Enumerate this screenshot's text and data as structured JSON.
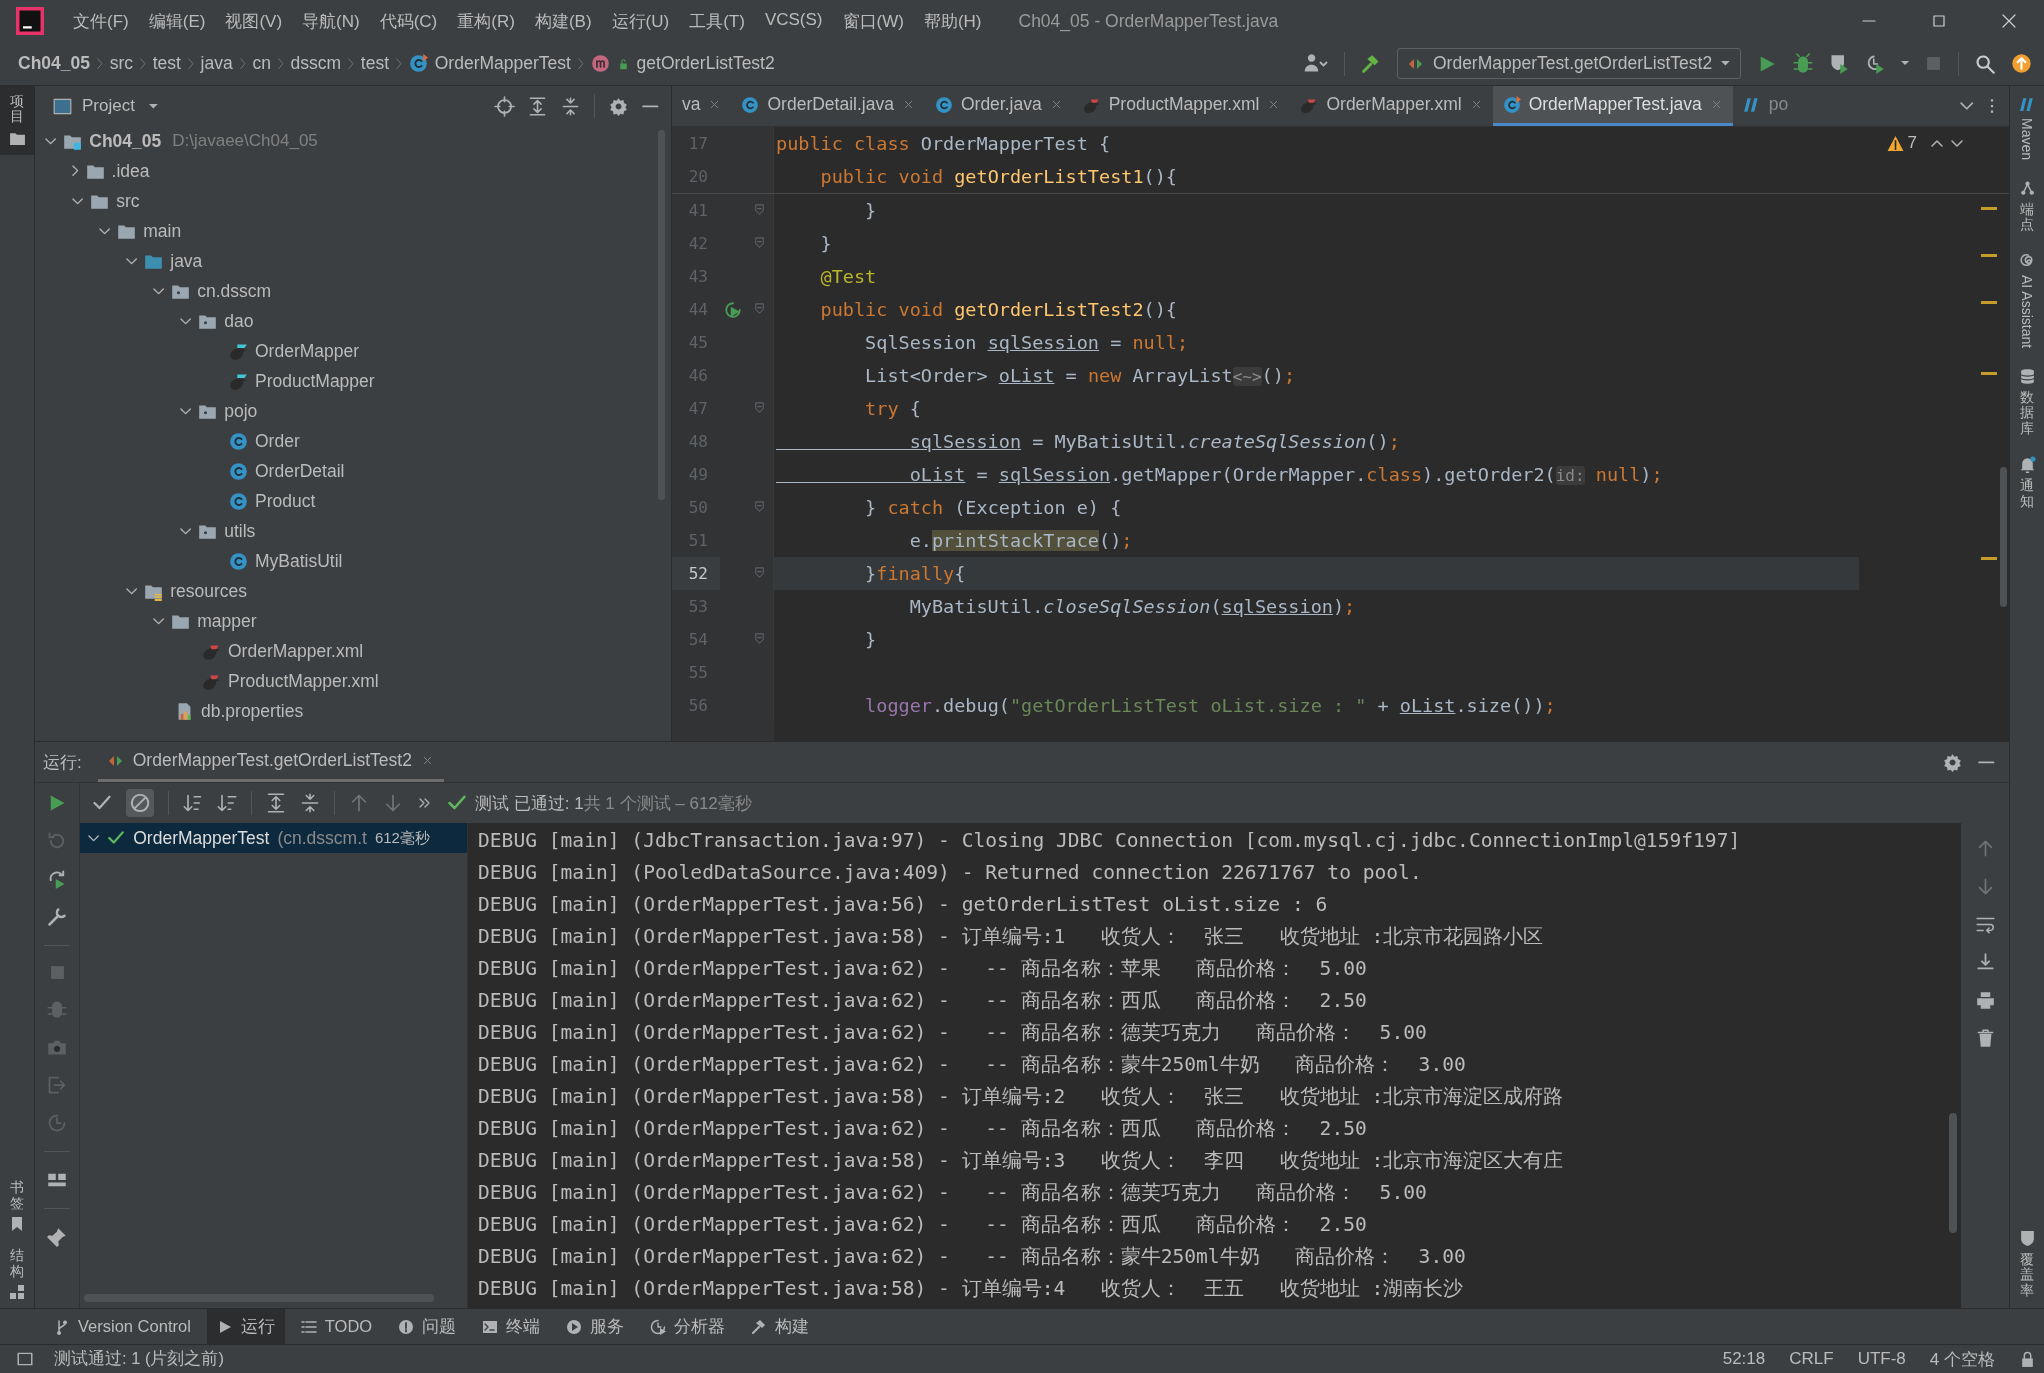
{
  "window": {
    "title": "Ch04_05 - OrderMapperTest.java"
  },
  "menu": [
    "文件(F)",
    "编辑(E)",
    "视图(V)",
    "导航(N)",
    "代码(C)",
    "重构(R)",
    "构建(B)",
    "运行(U)",
    "工具(T)",
    "VCS(S)",
    "窗口(W)",
    "帮助(H)"
  ],
  "breadcrumbs": [
    {
      "label": "Ch04_05",
      "kind": "module"
    },
    {
      "label": "src",
      "kind": "dir"
    },
    {
      "label": "test",
      "kind": "dir"
    },
    {
      "label": "java",
      "kind": "dir"
    },
    {
      "label": "cn",
      "kind": "dir"
    },
    {
      "label": "dsscm",
      "kind": "dir"
    },
    {
      "label": "test",
      "kind": "dir"
    },
    {
      "label": "OrderMapperTest",
      "kind": "class"
    },
    {
      "label": "getOrderListTest2",
      "kind": "method"
    }
  ],
  "run_config": {
    "label": "OrderMapperTest.getOrderListTest2"
  },
  "left_stripe": {
    "top": [
      {
        "label": "项目",
        "kind": "project",
        "selected": true
      }
    ],
    "bottom": [
      {
        "label": "书签",
        "kind": "bookmarks",
        "selected": false
      },
      {
        "label": "结构",
        "kind": "structure",
        "selected": false
      }
    ]
  },
  "right_stripe": {
    "top": [
      {
        "label": "Maven",
        "kind": "maven"
      },
      {
        "label": "端点",
        "kind": "endpoints"
      },
      {
        "label": "AI Assistant",
        "kind": "ai"
      },
      {
        "label": "数据库",
        "kind": "database"
      },
      {
        "label": "通知",
        "kind": "notifications"
      }
    ],
    "bottom": [
      {
        "label": "覆盖率",
        "kind": "coverage"
      }
    ]
  },
  "project": {
    "title": "Project",
    "tree": [
      {
        "label": "Ch04_05",
        "path": "D:\\javaee\\Ch04_05",
        "kind": "module",
        "expanded": true,
        "children": [
          {
            "label": ".idea",
            "kind": "folder",
            "expanded": false
          },
          {
            "label": "src",
            "kind": "folder",
            "expanded": true,
            "children": [
              {
                "label": "main",
                "kind": "folder",
                "expanded": true,
                "children": [
                  {
                    "label": "java",
                    "kind": "source",
                    "expanded": true,
                    "children": [
                      {
                        "label": "cn.dsscm",
                        "kind": "package",
                        "expanded": true,
                        "children": [
                          {
                            "label": "dao",
                            "kind": "package",
                            "expanded": true,
                            "children": [
                              {
                                "label": "OrderMapper",
                                "kind": "mapper"
                              },
                              {
                                "label": "ProductMapper",
                                "kind": "mapper"
                              }
                            ]
                          },
                          {
                            "label": "pojo",
                            "kind": "package",
                            "expanded": true,
                            "children": [
                              {
                                "label": "Order",
                                "kind": "class"
                              },
                              {
                                "label": "OrderDetail",
                                "kind": "class"
                              },
                              {
                                "label": "Product",
                                "kind": "class"
                              }
                            ]
                          },
                          {
                            "label": "utils",
                            "kind": "package",
                            "expanded": true,
                            "children": [
                              {
                                "label": "MyBatisUtil",
                                "kind": "class"
                              }
                            ]
                          }
                        ]
                      }
                    ]
                  },
                  {
                    "label": "resources",
                    "kind": "resources",
                    "expanded": true,
                    "children": [
                      {
                        "label": "mapper",
                        "kind": "folder",
                        "expanded": true,
                        "children": [
                          {
                            "label": "OrderMapper.xml",
                            "kind": "xml"
                          },
                          {
                            "label": "ProductMapper.xml",
                            "kind": "xml"
                          }
                        ]
                      },
                      {
                        "label": "db.properties",
                        "kind": "properties"
                      }
                    ]
                  }
                ]
              }
            ]
          }
        ]
      }
    ]
  },
  "editor": {
    "tabs": [
      {
        "label": "va",
        "kind": "plain",
        "selected": false,
        "closable": true
      },
      {
        "label": "OrderDetail.java",
        "kind": "class",
        "selected": false,
        "closable": true
      },
      {
        "label": "Order.java",
        "kind": "class",
        "selected": false,
        "closable": true
      },
      {
        "label": "ProductMapper.xml",
        "kind": "xml",
        "selected": false,
        "closable": true
      },
      {
        "label": "OrderMapper.xml",
        "kind": "xml",
        "selected": false,
        "closable": true
      },
      {
        "label": "OrderMapperTest.java",
        "kind": "test-class",
        "selected": true,
        "closable": true
      },
      {
        "label": "po",
        "kind": "maven",
        "selected": false,
        "closable": false
      }
    ],
    "warnings": "7",
    "sticky_lines": [
      {
        "number": "17",
        "tokens": [
          {
            "text": "public class ",
            "kind": "keyword"
          },
          {
            "text": "OrderMapperTest {",
            "kind": "plain"
          }
        ]
      },
      {
        "number": "20",
        "tokens": [
          {
            "text": "    public void ",
            "kind": "keyword"
          },
          {
            "text": "getOrderListTest1",
            "kind": "method"
          },
          {
            "text": "(){",
            "kind": "plain"
          }
        ]
      }
    ],
    "lines": [
      {
        "number": "41",
        "fold": true,
        "run_marker": false,
        "current": false,
        "tokens": [
          {
            "text": "        }",
            "kind": "plain"
          }
        ]
      },
      {
        "number": "42",
        "fold": true,
        "run_marker": false,
        "current": false,
        "tokens": [
          {
            "text": "    }",
            "kind": "plain"
          }
        ]
      },
      {
        "number": "43",
        "fold": false,
        "run_marker": false,
        "current": false,
        "tokens": [
          {
            "text": "    @Test",
            "kind": "annotation"
          }
        ]
      },
      {
        "number": "44",
        "fold": true,
        "run_marker": true,
        "current": false,
        "tokens": [
          {
            "text": "    public void ",
            "kind": "keyword"
          },
          {
            "text": "getOrderListTest2",
            "kind": "method"
          },
          {
            "text": "(){",
            "kind": "plain"
          }
        ]
      },
      {
        "number": "45",
        "fold": false,
        "run_marker": false,
        "current": false,
        "tokens": [
          {
            "text": "        SqlSession ",
            "kind": "plain"
          },
          {
            "text": "sqlSession",
            "kind": "variable"
          },
          {
            "text": " = ",
            "kind": "plain"
          },
          {
            "text": "null;",
            "kind": "keyword"
          }
        ]
      },
      {
        "number": "46",
        "fold": false,
        "run_marker": false,
        "current": false,
        "tokens": [
          {
            "text": "        List<Order> ",
            "kind": "plain"
          },
          {
            "text": "oList",
            "kind": "variable"
          },
          {
            "text": " = ",
            "kind": "plain"
          },
          {
            "text": "new ",
            "kind": "keyword"
          },
          {
            "text": "ArrayList",
            "kind": "plain"
          },
          {
            "text": "<~>",
            "kind": "hint"
          },
          {
            "text": "()",
            "kind": "plain"
          },
          {
            "text": ";",
            "kind": "keyword"
          }
        ]
      },
      {
        "number": "47",
        "fold": true,
        "run_marker": false,
        "current": false,
        "tokens": [
          {
            "text": "        try ",
            "kind": "keyword"
          },
          {
            "text": "{",
            "kind": "plain"
          }
        ]
      },
      {
        "number": "48",
        "fold": false,
        "run_marker": false,
        "current": false,
        "tokens": [
          {
            "text": "            sqlSession",
            "kind": "variable"
          },
          {
            "text": " = MyBatisUtil.",
            "kind": "plain"
          },
          {
            "text": "createSqlSession",
            "kind": "static"
          },
          {
            "text": "()",
            "kind": "plain"
          },
          {
            "text": ";",
            "kind": "keyword"
          }
        ]
      },
      {
        "number": "49",
        "fold": false,
        "run_marker": false,
        "current": false,
        "tokens": [
          {
            "text": "            oList",
            "kind": "variable"
          },
          {
            "text": " = ",
            "kind": "plain"
          },
          {
            "text": "sqlSession",
            "kind": "variable"
          },
          {
            "text": ".getMapper(OrderMapper.",
            "kind": "plain"
          },
          {
            "text": "class",
            "kind": "keyword"
          },
          {
            "text": ").getOrder2(",
            "kind": "plain"
          },
          {
            "text": "id:",
            "kind": "hint"
          },
          {
            "text": " null",
            "kind": "keyword"
          },
          {
            "text": ")",
            "kind": "plain"
          },
          {
            "text": ";",
            "kind": "keyword"
          }
        ]
      },
      {
        "number": "50",
        "fold": true,
        "run_marker": false,
        "current": false,
        "tokens": [
          {
            "text": "        } ",
            "kind": "plain"
          },
          {
            "text": "catch ",
            "kind": "keyword"
          },
          {
            "text": "(Exception e) {",
            "kind": "plain"
          }
        ]
      },
      {
        "number": "51",
        "fold": false,
        "run_marker": false,
        "current": false,
        "tokens": [
          {
            "text": "            e.",
            "kind": "plain"
          },
          {
            "text": "printStackTrace",
            "kind": "highlight"
          },
          {
            "text": "()",
            "kind": "plain"
          },
          {
            "text": ";",
            "kind": "keyword"
          }
        ]
      },
      {
        "number": "52",
        "fold": true,
        "run_marker": false,
        "current": true,
        "tokens": [
          {
            "text": "        }",
            "kind": "plain"
          },
          {
            "text": "finally",
            "kind": "keyword"
          },
          {
            "text": "{",
            "kind": "plain"
          }
        ]
      },
      {
        "number": "53",
        "fold": false,
        "run_marker": false,
        "current": false,
        "tokens": [
          {
            "text": "            MyBatisUtil.",
            "kind": "plain"
          },
          {
            "text": "closeSqlSession",
            "kind": "static"
          },
          {
            "text": "(",
            "kind": "plain"
          },
          {
            "text": "sqlSession",
            "kind": "variable"
          },
          {
            "text": ")",
            "kind": "plain"
          },
          {
            "text": ";",
            "kind": "keyword"
          }
        ]
      },
      {
        "number": "54",
        "fold": true,
        "run_marker": false,
        "current": false,
        "tokens": [
          {
            "text": "        }",
            "kind": "plain"
          }
        ]
      },
      {
        "number": "55",
        "fold": false,
        "run_marker": false,
        "current": false
      },
      {
        "number": "56",
        "fold": false,
        "run_marker": false,
        "current": false,
        "tokens": [
          {
            "text": "        logger",
            "kind": "field"
          },
          {
            "text": ".debug(",
            "kind": "plain"
          },
          {
            "text": "\"getOrderListTest oList.size : \"",
            "kind": "string"
          },
          {
            "text": " + ",
            "kind": "plain"
          },
          {
            "text": "oList",
            "kind": "variable"
          },
          {
            "text": ".size())",
            "kind": "plain"
          },
          {
            "text": ";",
            "kind": "keyword"
          }
        ]
      }
    ]
  },
  "run": {
    "label": "运行:",
    "tab": "OrderMapperTest.getOrderListTest2",
    "status": "测试 已通过: 1",
    "summary": "共 1 个测试 – 612毫秒",
    "tests": [
      {
        "name": "OrderMapperTest",
        "detail": "(cn.dsscm.t",
        "time": "612毫秒",
        "passed": true,
        "expanded": true,
        "selected": true
      }
    ],
    "console": [
      "DEBUG [main] (JdbcTransaction.java:97) - Closing JDBC Connection [com.mysql.cj.jdbc.ConnectionImpl@159f197]",
      "DEBUG [main] (PooledDataSource.java:409) - Returned connection 22671767 to pool.",
      "DEBUG [main] (OrderMapperTest.java:56) - getOrderListTest oList.size : 6",
      "DEBUG [main] (OrderMapperTest.java:58) - 订单编号:1   收货人：  张三   收货地址 :北京市花园路小区",
      "DEBUG [main] (OrderMapperTest.java:62) -   -- 商品名称：苹果   商品价格：  5.00",
      "DEBUG [main] (OrderMapperTest.java:62) -   -- 商品名称：西瓜   商品价格：  2.50",
      "DEBUG [main] (OrderMapperTest.java:62) -   -- 商品名称：德芙巧克力   商品价格：  5.00",
      "DEBUG [main] (OrderMapperTest.java:62) -   -- 商品名称：蒙牛250ml牛奶   商品价格：  3.00",
      "DEBUG [main] (OrderMapperTest.java:58) - 订单编号:2   收货人：  张三   收货地址 :北京市海淀区成府路",
      "DEBUG [main] (OrderMapperTest.java:62) -   -- 商品名称：西瓜   商品价格：  2.50",
      "DEBUG [main] (OrderMapperTest.java:58) - 订单编号:3   收货人：  李四   收货地址 :北京市海淀区大有庄",
      "DEBUG [main] (OrderMapperTest.java:62) -   -- 商品名称：德芙巧克力   商品价格：  5.00",
      "DEBUG [main] (OrderMapperTest.java:62) -   -- 商品名称：西瓜   商品价格：  2.50",
      "DEBUG [main] (OrderMapperTest.java:62) -   -- 商品名称：蒙牛250ml牛奶   商品价格：  3.00",
      "DEBUG [main] (OrderMapperTest.java:58) - 订单编号:4   收货人：  王五   收货地址 :湖南长沙"
    ]
  },
  "tool_tabs": [
    {
      "label": "Version Control",
      "kind": "vcs",
      "selected": false
    },
    {
      "label": "运行",
      "kind": "run",
      "selected": true
    },
    {
      "label": "TODO",
      "kind": "todo",
      "selected": false
    },
    {
      "label": "问题",
      "kind": "problems",
      "selected": false
    },
    {
      "label": "终端",
      "kind": "terminal",
      "selected": false
    },
    {
      "label": "服务",
      "kind": "services",
      "selected": false
    },
    {
      "label": "分析器",
      "kind": "profiler",
      "selected": false
    },
    {
      "label": "构建",
      "kind": "build",
      "selected": false
    }
  ],
  "status_bar": {
    "message": "测试通过: 1 (片刻之前)",
    "position": "52:18",
    "line_separator": "CRLF",
    "encoding": "UTF-8",
    "indent": "4 个空格"
  }
}
